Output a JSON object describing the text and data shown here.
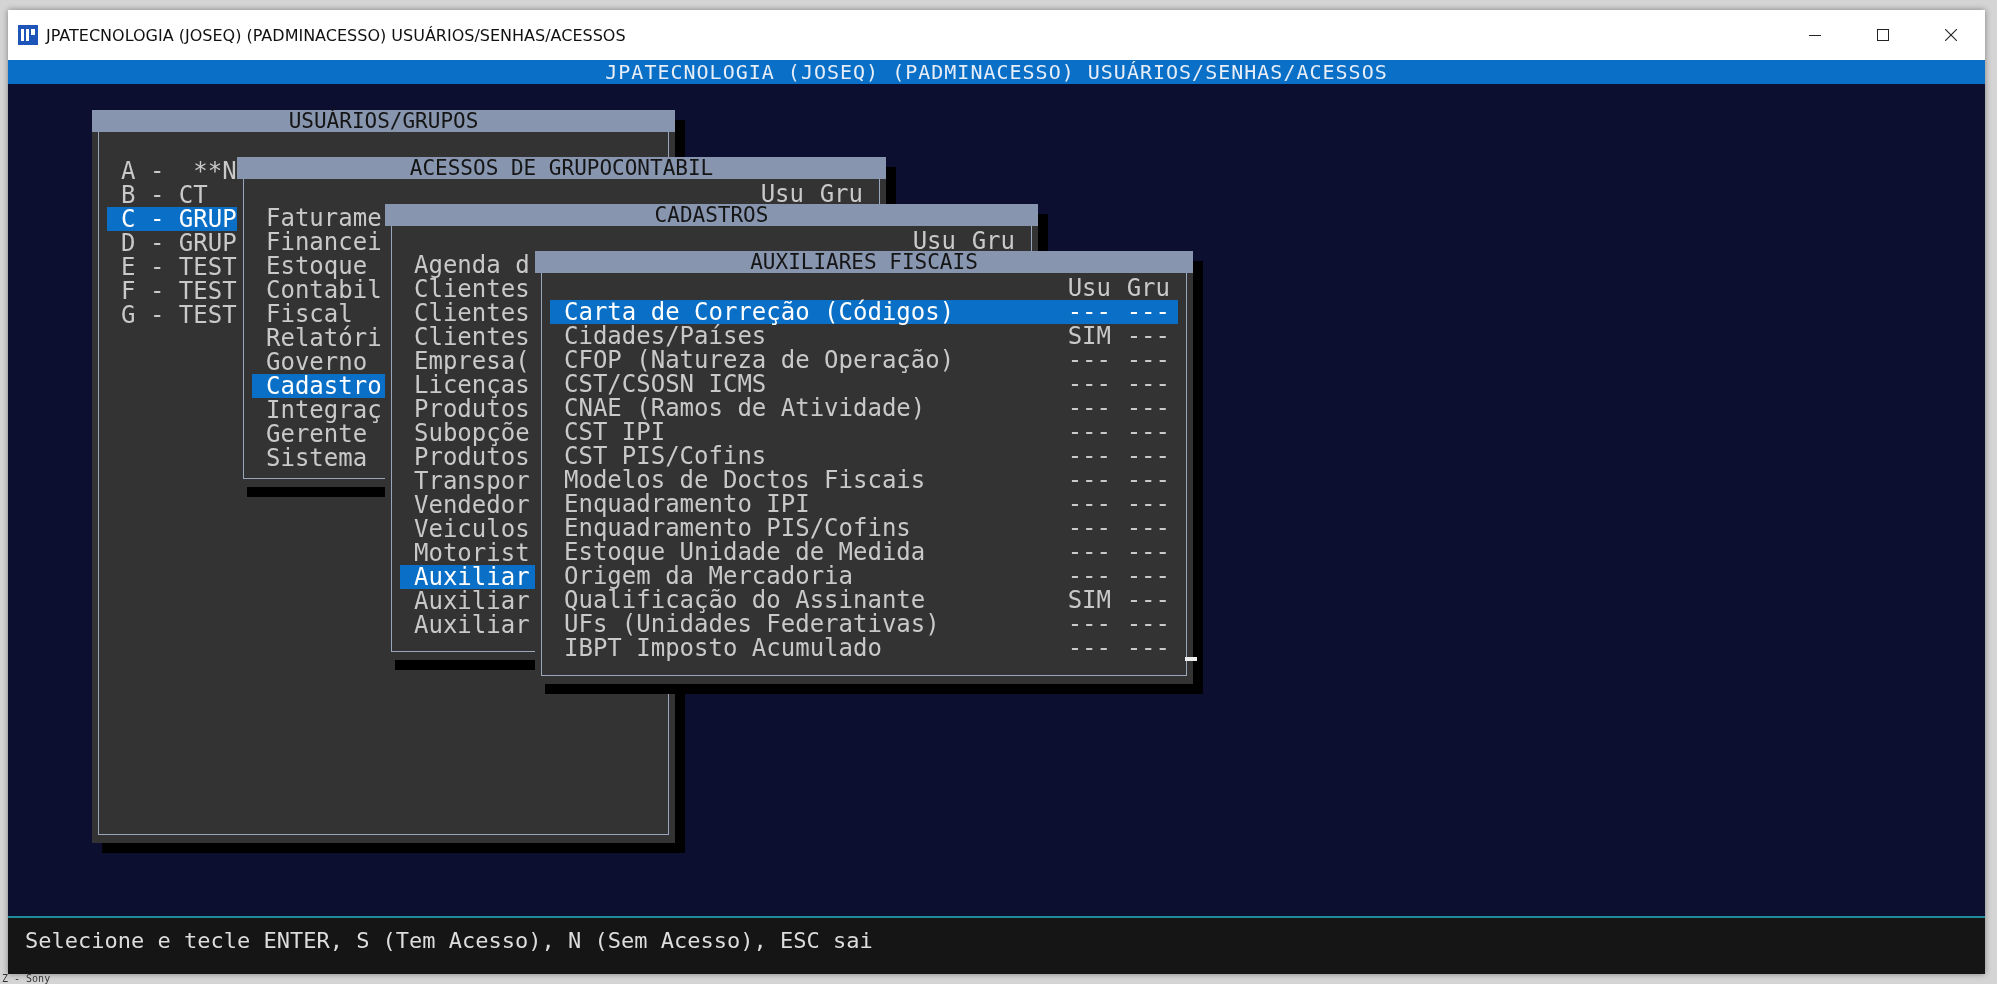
{
  "window": {
    "title": "JPATECNOLOGIA (JOSEQ) (PADMINACESSO) USUÁRIOS/SENHAS/ACESSOS"
  },
  "header": "JPATECNOLOGIA (JOSEQ) (PADMINACESSO) USUÁRIOS/SENHAS/ACESSOS",
  "dialogs": [
    {
      "title": "USUÁRIOS/GRUPOS",
      "items": [
        {
          "label": "A -  **N",
          "selected": false
        },
        {
          "label": "B - CT",
          "selected": false
        },
        {
          "label": "C - GRUP",
          "selected": true
        },
        {
          "label": "D - GRUP",
          "selected": false
        },
        {
          "label": "E - TEST",
          "selected": false
        },
        {
          "label": "F - TEST",
          "selected": false
        },
        {
          "label": "G - TEST",
          "selected": false
        }
      ]
    },
    {
      "title": "ACESSOS DE GRUPOCONTABIL",
      "columns": [
        "Usu",
        "Gru"
      ],
      "items": [
        {
          "label": "Faturame",
          "selected": false
        },
        {
          "label": "Financei",
          "selected": false
        },
        {
          "label": "Estoque",
          "selected": false
        },
        {
          "label": "Contabil",
          "selected": false
        },
        {
          "label": "Fiscal",
          "selected": false
        },
        {
          "label": "Relatóri",
          "selected": false
        },
        {
          "label": "Governo",
          "selected": false
        },
        {
          "label": "Cadastro",
          "selected": true
        },
        {
          "label": "Integraç",
          "selected": false
        },
        {
          "label": "Gerente",
          "selected": false
        },
        {
          "label": "Sistema",
          "selected": false
        }
      ]
    },
    {
      "title": "CADASTROS",
      "columns": [
        "Usu",
        "Gru"
      ],
      "items": [
        {
          "label": "Agenda d",
          "selected": false
        },
        {
          "label": "Clientes",
          "selected": false
        },
        {
          "label": "Clientes",
          "selected": false
        },
        {
          "label": "Clientes",
          "selected": false
        },
        {
          "label": "Empresa(",
          "selected": false
        },
        {
          "label": "Licenças",
          "selected": false
        },
        {
          "label": "Produtos",
          "selected": false
        },
        {
          "label": "Subopçõe",
          "selected": false
        },
        {
          "label": "Produtos",
          "selected": false
        },
        {
          "label": "Transpor",
          "selected": false
        },
        {
          "label": "Vendedor",
          "selected": false
        },
        {
          "label": "Veiculos",
          "selected": false
        },
        {
          "label": "Motorist",
          "selected": false
        },
        {
          "label": "Auxiliar",
          "selected": true
        },
        {
          "label": "Auxiliar",
          "selected": false
        },
        {
          "label": "Auxiliar",
          "selected": false
        }
      ]
    },
    {
      "title": "AUXILIARES FISCAIS",
      "columns": [
        "Usu",
        "Gru"
      ],
      "items": [
        {
          "label": "Carta de Correção (Códigos)",
          "usu": "---",
          "gru": "---",
          "selected": true
        },
        {
          "label": "Cidades/Países",
          "usu": "SIM",
          "gru": "---",
          "selected": false
        },
        {
          "label": "CFOP (Natureza de Operação)",
          "usu": "---",
          "gru": "---",
          "selected": false
        },
        {
          "label": "CST/CSOSN ICMS",
          "usu": "---",
          "gru": "---",
          "selected": false
        },
        {
          "label": "CNAE (Ramos de Atividade)",
          "usu": "---",
          "gru": "---",
          "selected": false
        },
        {
          "label": "CST IPI",
          "usu": "---",
          "gru": "---",
          "selected": false
        },
        {
          "label": "CST PIS/Cofins",
          "usu": "---",
          "gru": "---",
          "selected": false
        },
        {
          "label": "Modelos de Doctos Fiscais",
          "usu": "---",
          "gru": "---",
          "selected": false
        },
        {
          "label": "Enquadramento IPI",
          "usu": "---",
          "gru": "---",
          "selected": false
        },
        {
          "label": "Enquadramento PIS/Cofins",
          "usu": "---",
          "gru": "---",
          "selected": false
        },
        {
          "label": "Estoque Unidade de Medida",
          "usu": "---",
          "gru": "---",
          "selected": false
        },
        {
          "label": "Origem da Mercadoria",
          "usu": "---",
          "gru": "---",
          "selected": false
        },
        {
          "label": "Qualificação do Assinante",
          "usu": "SIM",
          "gru": "---",
          "selected": false
        },
        {
          "label": "UFs (Unidades Federativas)",
          "usu": "---",
          "gru": "---",
          "selected": false
        },
        {
          "label": "IBPT Imposto Acumulado",
          "usu": "---",
          "gru": "---",
          "selected": false
        }
      ]
    }
  ],
  "status_bar": "Selecione e tecle ENTER, S (Tem Acesso), N (Sem Acesso), ESC sai",
  "background_text": "Z - Sony"
}
